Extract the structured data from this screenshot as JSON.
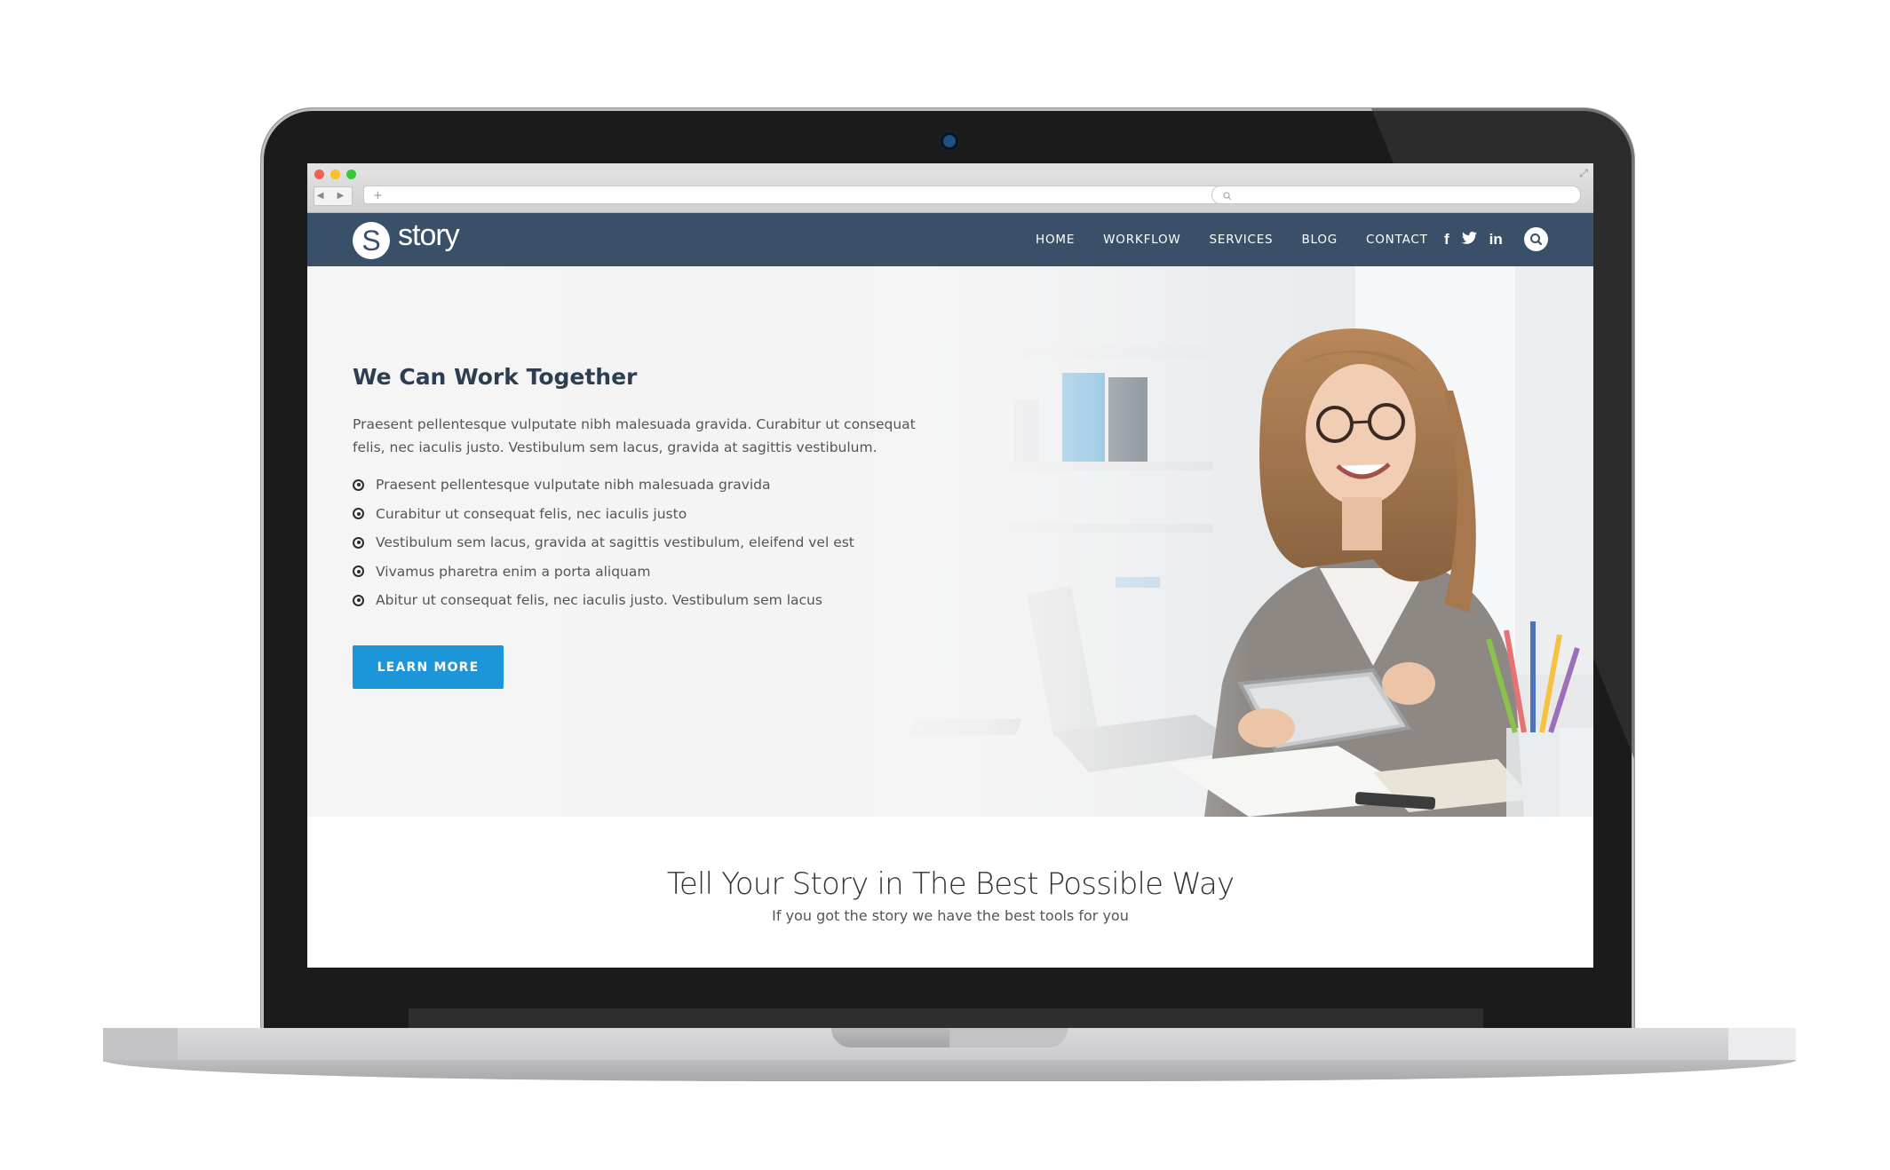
{
  "browser": {
    "url_placeholder": "+",
    "nav_arrows": "◀ ▶",
    "search_icon": "search-icon",
    "resize_icon": "⤢"
  },
  "header": {
    "logo_letter": "S",
    "logo_text": "story",
    "menu": [
      "HOME",
      "WORKFLOW",
      "SERVICES",
      "BLOG",
      "CONTACT"
    ],
    "social": [
      "f",
      "t",
      "in"
    ]
  },
  "hero": {
    "title": "We Can Work Together",
    "paragraph": "Praesent pellentesque vulputate nibh malesuada gravida. Curabitur ut consequat felis, nec iaculis justo. Vestibulum sem lacus, gravida at sagittis vestibulum.",
    "bullets": [
      "Praesent pellentesque vulputate nibh malesuada gravida",
      "Curabitur ut consequat felis, nec iaculis justo",
      "Vestibulum sem lacus, gravida at sagittis vestibulum, eleifend vel est",
      "Vivamus pharetra enim a porta aliquam",
      "Abitur ut consequat felis, nec iaculis justo. Vestibulum sem lacus"
    ],
    "button_label": "LEARN MORE"
  },
  "section": {
    "title": "Tell Your Story in The Best Possible Way",
    "subtitle": "If you got the story we have the best tools for you"
  },
  "colors": {
    "nav_bg": "#3a5069",
    "accent": "#1c95d9",
    "heading": "#2c3e50"
  }
}
